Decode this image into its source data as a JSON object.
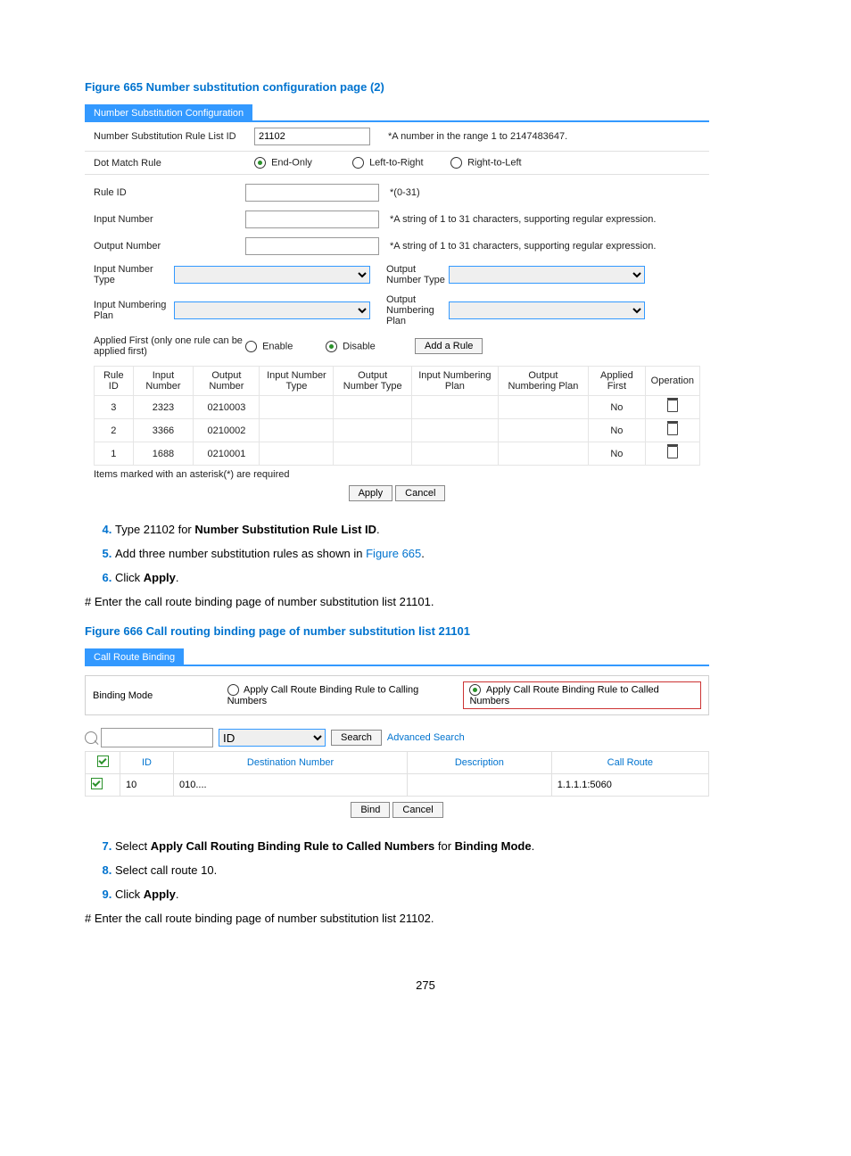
{
  "fig665": {
    "caption": "Figure 665 Number substitution configuration page (2)",
    "titlebar": "Number Substitution Configuration",
    "list_id_label": "Number Substitution Rule List ID",
    "list_id_value": "21102",
    "list_id_hint": "*A number in the range 1 to 2147483647.",
    "dot_match_label": "Dot Match Rule",
    "dot_end_only": "End-Only",
    "dot_ltr": "Left-to-Right",
    "dot_rtl": "Right-to-Left",
    "rule_id_label": "Rule ID",
    "rule_id_hint": "*(0-31)",
    "input_number_label": "Input Number",
    "input_number_hint": "*A string of 1 to 31 characters, supporting regular expression.",
    "output_number_label": "Output Number",
    "output_number_hint": "*A string of 1 to 31 characters, supporting regular expression.",
    "in_num_type_label": "Input Number Type",
    "out_num_type_label": "Output Number Type",
    "in_plan_label": "Input Numbering Plan",
    "out_plan_label": "Output Numbering Plan",
    "applied_first_label": "Applied First (only one rule can be applied first)",
    "enable": "Enable",
    "disable": "Disable",
    "add_rule": "Add a Rule",
    "note": "Items marked with an asterisk(*) are required",
    "apply": "Apply",
    "cancel": "Cancel",
    "table_headers": {
      "rule_id": "Rule ID",
      "input_number": "Input Number",
      "output_number": "Output Number",
      "in_num_type": "Input Number Type",
      "out_num_type": "Output Number Type",
      "in_plan": "Input Numbering Plan",
      "out_plan": "Output Numbering Plan",
      "applied_first": "Applied First",
      "operation": "Operation"
    },
    "rows": [
      {
        "rule_id": "3",
        "input_number": "2323",
        "output_number": "0210003",
        "applied_first": "No"
      },
      {
        "rule_id": "2",
        "input_number": "3366",
        "output_number": "0210002",
        "applied_first": "No"
      },
      {
        "rule_id": "1",
        "input_number": "1688",
        "output_number": "0210001",
        "applied_first": "No"
      }
    ]
  },
  "steps_a": {
    "s4_pre": "Type 21102 for ",
    "s4_bold": "Number Substitution Rule List ID",
    "s5_pre": "Add three number substitution rules as shown in ",
    "s5_link": "Figure 665",
    "s6_pre": "Click ",
    "s6_bold": "Apply"
  },
  "para1": "# Enter the call route binding page of number substitution list 21101.",
  "fig666": {
    "caption": "Figure 666 Call routing binding page of number substitution list 21101",
    "titlebar": "Call Route Binding",
    "binding_mode_label": "Binding Mode",
    "opt_calling": "Apply Call Route Binding Rule to Calling Numbers",
    "opt_called": "Apply Call Route Binding Rule to Called Numbers",
    "search_field_label": "ID",
    "search_btn": "Search",
    "adv_search": "Advanced Search",
    "headers": {
      "id": "ID",
      "dest": "Destination Number",
      "desc": "Description",
      "call_route": "Call Route"
    },
    "row": {
      "id": "10",
      "dest": "010....",
      "desc": "",
      "call_route": "1.1.1.1:5060"
    },
    "bind": "Bind",
    "cancel": "Cancel"
  },
  "steps_b": {
    "s7_pre": "Select ",
    "s7_b1": "Apply Call Routing Binding Rule to Called Numbers",
    "s7_mid": " for ",
    "s7_b2": "Binding Mode",
    "s8": "Select call route 10.",
    "s9_pre": "Click ",
    "s9_bold": "Apply"
  },
  "para2": "# Enter the call route binding page of number substitution list 21102.",
  "page_number": "275"
}
